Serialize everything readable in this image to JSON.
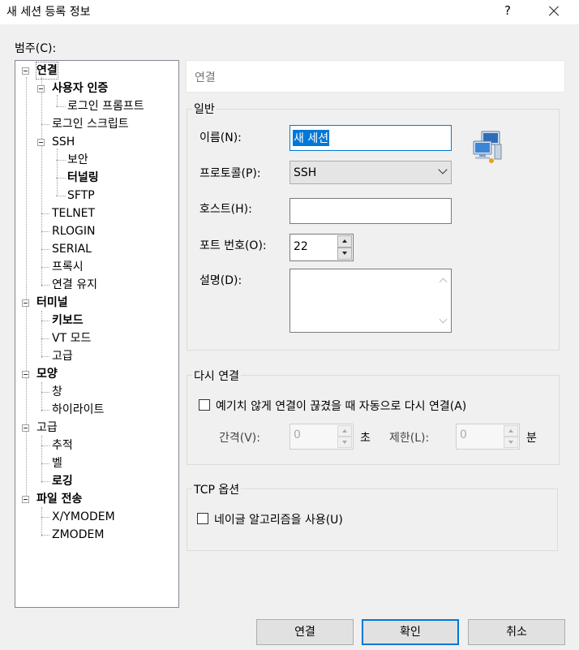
{
  "window": {
    "title": "새 세션 등록 정보",
    "help": "?"
  },
  "category_label": "범주(C):",
  "tree": {
    "items": [
      {
        "label": "연결",
        "bold": true
      },
      {
        "label": "사용자 인증",
        "bold": true
      },
      {
        "label": "로그인 프롬프트",
        "bold": false
      },
      {
        "label": "로그인 스크립트",
        "bold": false
      },
      {
        "label": "SSH",
        "bold": false
      },
      {
        "label": "보안",
        "bold": false
      },
      {
        "label": "터널링",
        "bold": true
      },
      {
        "label": "SFTP",
        "bold": false
      },
      {
        "label": "TELNET",
        "bold": false
      },
      {
        "label": "RLOGIN",
        "bold": false
      },
      {
        "label": "SERIAL",
        "bold": false
      },
      {
        "label": "프록시",
        "bold": false
      },
      {
        "label": "연결 유지",
        "bold": false
      },
      {
        "label": "터미널",
        "bold": true
      },
      {
        "label": "키보드",
        "bold": true
      },
      {
        "label": "VT 모드",
        "bold": false
      },
      {
        "label": "고급",
        "bold": false
      },
      {
        "label": "모양",
        "bold": true
      },
      {
        "label": "창",
        "bold": false
      },
      {
        "label": "하이라이트",
        "bold": false
      },
      {
        "label": "고급",
        "bold": false
      },
      {
        "label": "추적",
        "bold": false
      },
      {
        "label": "벨",
        "bold": false
      },
      {
        "label": "로깅",
        "bold": true
      },
      {
        "label": "파일 전송",
        "bold": true
      },
      {
        "label": "X/YMODEM",
        "bold": false
      },
      {
        "label": "ZMODEM",
        "bold": false
      }
    ]
  },
  "page_header": "연결",
  "general": {
    "title": "일반",
    "name_label": "이름(N):",
    "name_value": "새 세션",
    "protocol_label": "프로토콜(P):",
    "protocol_value": "SSH",
    "host_label": "호스트(H):",
    "host_value": "",
    "port_label": "포트 번호(O):",
    "port_value": "22",
    "desc_label": "설명(D):",
    "desc_value": ""
  },
  "reconnect": {
    "title": "다시 연결",
    "checkbox_label": "예기치 않게 연결이 끊겼을 때 자동으로 다시 연결(A)",
    "checked": false,
    "interval_label": "간격(V):",
    "interval_value": "0",
    "interval_unit": "초",
    "limit_label": "제한(L):",
    "limit_value": "0",
    "limit_unit": "분"
  },
  "tcp": {
    "title": "TCP 옵션",
    "nagle_label": "네이글 알고리즘을 사용(U)",
    "checked": false
  },
  "buttons": {
    "connect": "연결",
    "ok": "확인",
    "cancel": "취소"
  },
  "icons": {
    "session_icon": "network-computers-icon"
  },
  "colors": {
    "selection": "#0078d7",
    "default_button_border": "#0078d7"
  }
}
